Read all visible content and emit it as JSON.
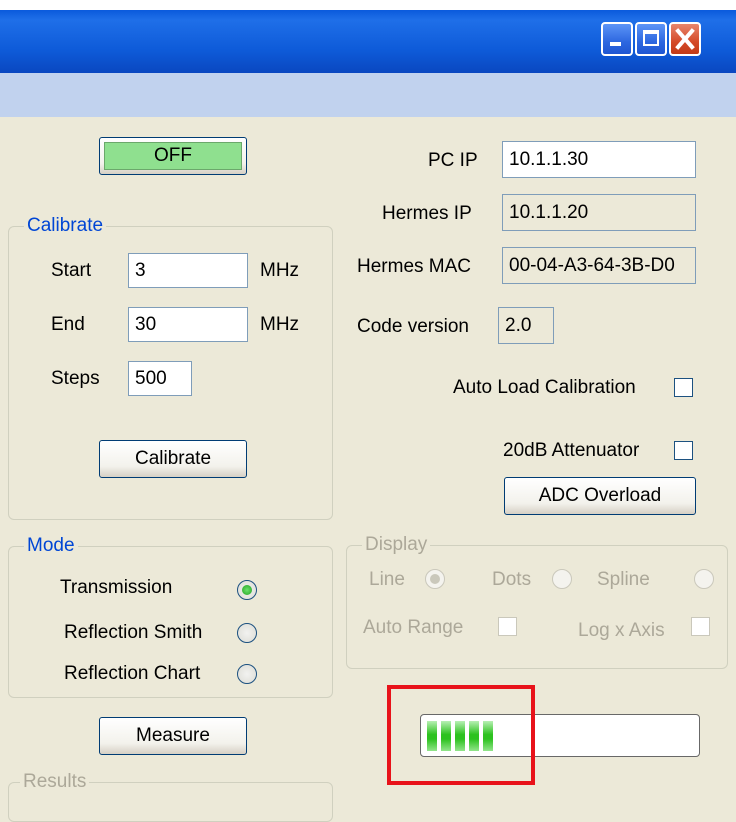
{
  "window": {
    "caption_buttons": [
      "minimize-icon",
      "maximize-icon",
      "close-icon"
    ]
  },
  "power": {
    "label": "OFF",
    "color": "#8FE08F"
  },
  "calibrate": {
    "title": "Calibrate",
    "start_label": "Start",
    "start_value": "3",
    "start_unit": "MHz",
    "end_label": "End",
    "end_value": "30",
    "end_unit": "MHz",
    "steps_label": "Steps",
    "steps_value": "500",
    "button_label": "Calibrate"
  },
  "network": {
    "pc_ip_label": "PC IP",
    "pc_ip_value": "10.1.1.30",
    "hermes_ip_label": "Hermes IP",
    "hermes_ip_value": "10.1.1.20",
    "hermes_mac_label": "Hermes MAC",
    "hermes_mac_value": "00-04-A3-64-3B-D0",
    "code_version_label": "Code version",
    "code_version_value": "2.0"
  },
  "options": {
    "auto_load_label": "Auto Load Calibration",
    "auto_load_checked": false,
    "attenuator_label": "20dB Attenuator",
    "attenuator_checked": false,
    "adc_overload_label": "ADC Overload"
  },
  "mode": {
    "title": "Mode",
    "options": [
      {
        "label": "Transmission",
        "selected": true
      },
      {
        "label": "Reflection Smith",
        "selected": false
      },
      {
        "label": "Reflection Chart",
        "selected": false
      }
    ]
  },
  "display": {
    "title": "Display",
    "line_label": "Line",
    "line_selected": true,
    "dots_label": "Dots",
    "dots_selected": false,
    "spline_label": "Spline",
    "spline_selected": false,
    "auto_range_label": "Auto Range",
    "auto_range_checked": false,
    "log_x_label": "Log x Axis",
    "log_x_checked": false
  },
  "measure": {
    "button_label": "Measure"
  },
  "progress": {
    "segments_filled": 5,
    "fraction": 0.3
  },
  "results": {
    "title": "Results"
  },
  "colors": {
    "highlight": "#E8121A",
    "progress_fill": "#2DC21F",
    "accent": "#0046D5"
  }
}
